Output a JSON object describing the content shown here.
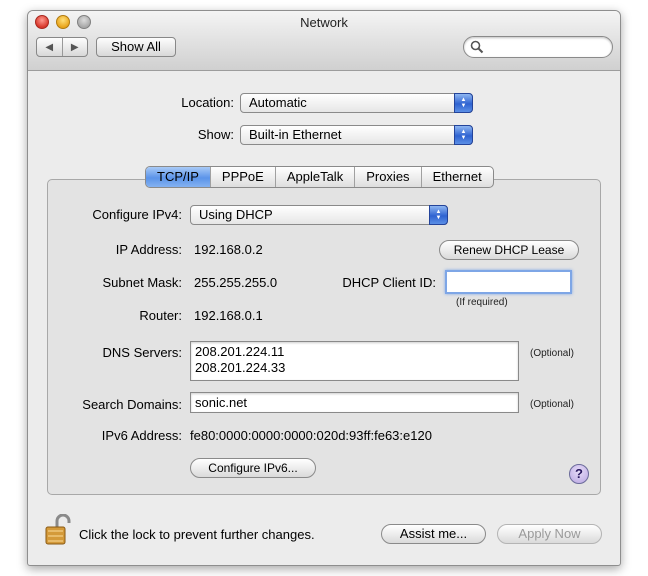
{
  "window": {
    "title": "Network"
  },
  "toolbar": {
    "back_glyph": "◀",
    "forward_glyph": "▶",
    "show_all_label": "Show All",
    "search_placeholder": "",
    "search_icon": "search-icon"
  },
  "location": {
    "label": "Location:",
    "value": "Automatic"
  },
  "show": {
    "label": "Show:",
    "value": "Built-in Ethernet"
  },
  "tabs": [
    {
      "label": "TCP/IP",
      "active": true
    },
    {
      "label": "PPPoE",
      "active": false
    },
    {
      "label": "AppleTalk",
      "active": false
    },
    {
      "label": "Proxies",
      "active": false
    },
    {
      "label": "Ethernet",
      "active": false
    }
  ],
  "tcpip": {
    "configure_label": "Configure IPv4:",
    "configure_value": "Using DHCP",
    "ip_label": "IP Address:",
    "ip_value": "192.168.0.2",
    "renew_label": "Renew DHCP Lease",
    "subnet_label": "Subnet Mask:",
    "subnet_value": "255.255.255.0",
    "client_id_label": "DHCP Client ID:",
    "client_id_value": "",
    "client_id_hint": "(If required)",
    "router_label": "Router:",
    "router_value": "192.168.0.1",
    "dns_label": "DNS Servers:",
    "dns_values": [
      "208.201.224.11",
      "208.201.224.33"
    ],
    "dns_hint": "(Optional)",
    "search_label": "Search Domains:",
    "search_value": "sonic.net",
    "search_hint": "(Optional)",
    "ipv6_label": "IPv6 Address:",
    "ipv6_value": "fe80:0000:0000:0000:020d:93ff:fe63:e120",
    "configure_ipv6_label": "Configure IPv6..."
  },
  "help": {
    "glyph": "?"
  },
  "footer": {
    "lock_text": "Click the lock to prevent further changes.",
    "assist_label": "Assist me...",
    "apply_label": "Apply Now"
  },
  "colors": {
    "accent": "#5b94e9",
    "window_bg": "#ececec",
    "panel_bg": "#e3e3e3"
  }
}
